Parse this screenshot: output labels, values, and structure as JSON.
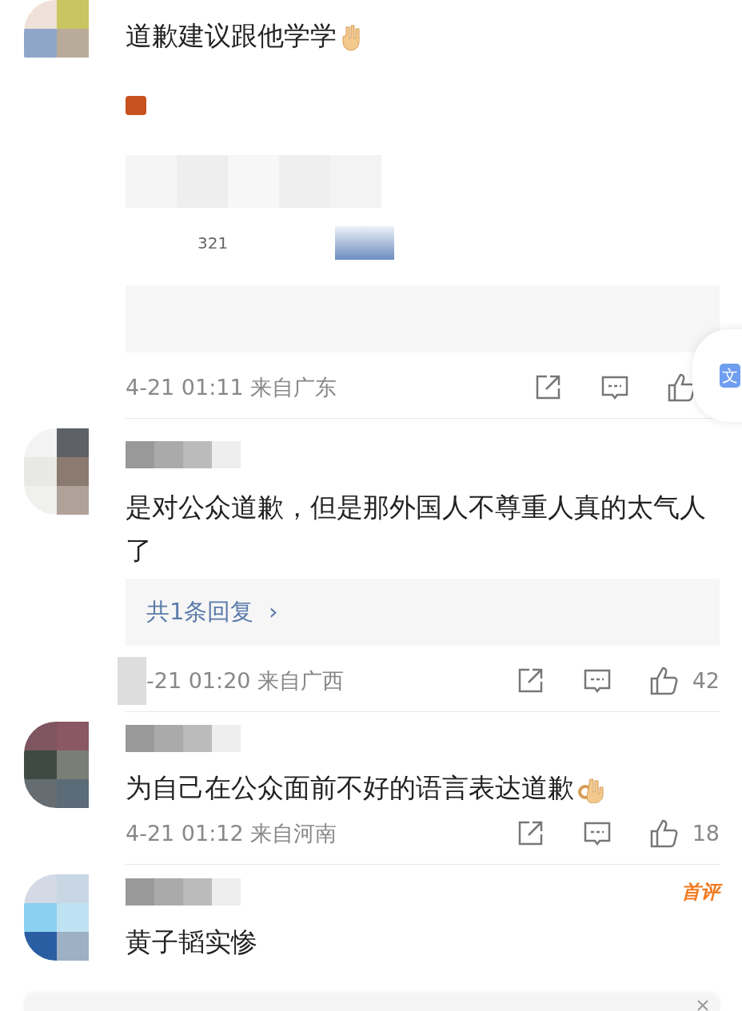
{
  "comments": [
    {
      "text": "道歉建议跟他学学",
      "quote": {
        "kind": "redacted",
        "text": "321"
      },
      "reply": {
        "kind": "redacted"
      },
      "time": "4-21 01:11",
      "location": "来自广东"
    },
    {
      "text": "是对公众道歉，但是那外国人不尊重人真的太气人了",
      "reply": {
        "kind": "link",
        "text": "共1条回复",
        "chevron": "›"
      },
      "time": "-21 01:20",
      "location": "来自广西",
      "likes": "42",
      "time_redacted": true
    },
    {
      "text": "为自己在公众面前不好的语言表达道歉",
      "time": "4-21 01:12",
      "location": "来自河南",
      "likes": "18"
    },
    {
      "text": "黄子韬实惨",
      "badge": "首评"
    }
  ],
  "translate_button": {
    "label": "文"
  }
}
